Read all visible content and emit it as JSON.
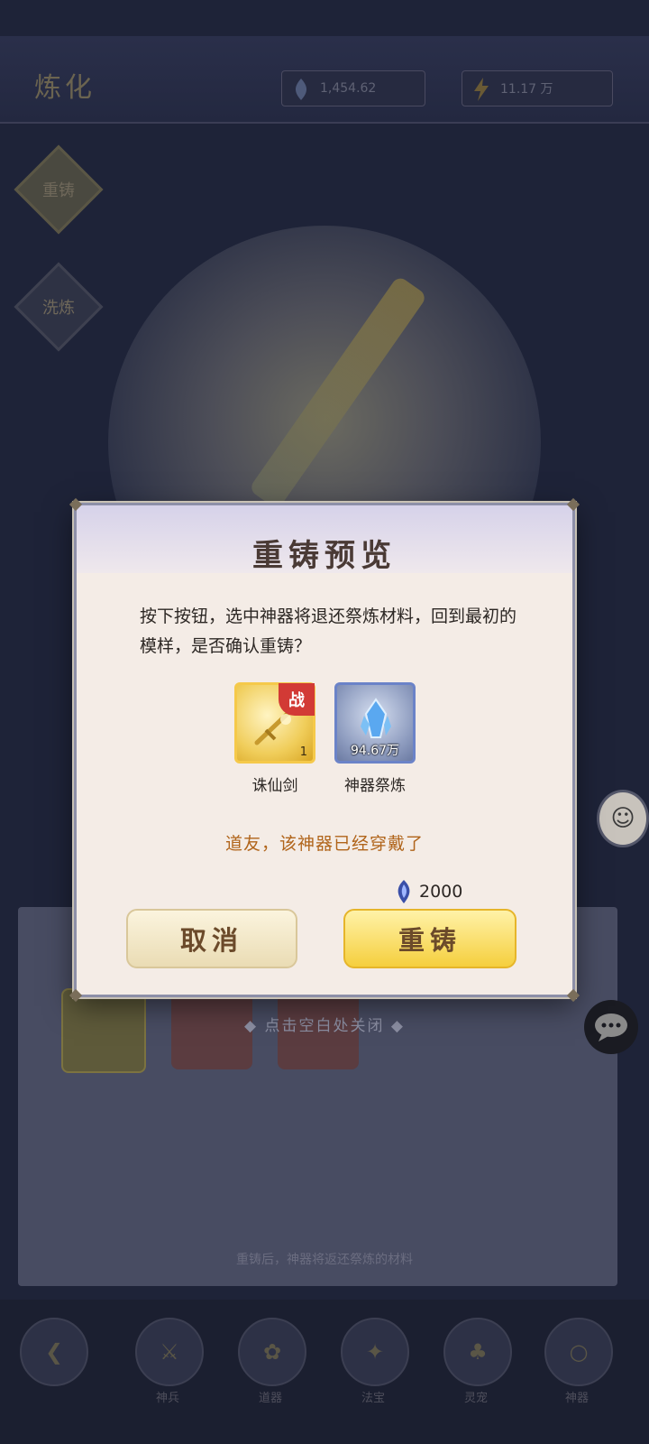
{
  "background": {
    "title": "炼化",
    "resource1": "1,454.62",
    "resource2": "11.17 万",
    "tab_recast": "重铸",
    "tab_other": "洗炼",
    "close_hint": "点击空白处关闭",
    "lower_note": "重铸后，神器将返还祭炼的材料",
    "nav": [
      {
        "label": "返回"
      },
      {
        "label": "神兵"
      },
      {
        "label": "道器"
      },
      {
        "label": "法宝"
      },
      {
        "label": "灵宠"
      },
      {
        "label": "神器"
      }
    ]
  },
  "modal": {
    "title": "重铸预览",
    "message": "按下按钮，选中神器将退还祭炼材料，回到最初的模样，是否确认重铸？",
    "items": [
      {
        "name": "诛仙剑",
        "badge": "战",
        "count": "1"
      },
      {
        "name": "神器祭炼",
        "amount": "94.67万"
      }
    ],
    "warning": "道友，该神器已经穿戴了",
    "cost": "2000",
    "cancel_label": "取消",
    "confirm_label": "重铸"
  },
  "colors": {
    "warning": "#b0641a",
    "gold_button": "#f5cf3e",
    "badge_red": "#d23a35"
  }
}
